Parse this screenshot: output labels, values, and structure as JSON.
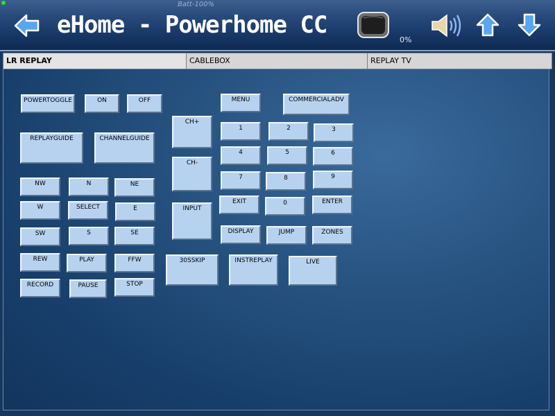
{
  "header": {
    "battery": "Batt-100%",
    "title": "eHome - Powerhome CC",
    "volume_percent": "0%",
    "icons": [
      "back-arrow-icon",
      "tv-screen-icon",
      "speaker-icon",
      "up-arrow-icon",
      "down-arrow-icon"
    ]
  },
  "tabs": [
    {
      "label": "LR REPLAY",
      "active": true
    },
    {
      "label": "CABLEBOX",
      "active": false
    },
    {
      "label": "REPLAY TV",
      "active": false
    }
  ],
  "buttons": {
    "powertoggle": "POWERTOGGLE",
    "on": "ON",
    "off": "OFF",
    "menu": "MENU",
    "commercialadv": "COMMERCIALADV",
    "ch_up": "CH+",
    "ch_down": "CH-",
    "replayguide": "REPLAYGUIDE",
    "channelguide": "CHANNELGUIDE",
    "n1": "1",
    "n2": "2",
    "n3": "3",
    "n4": "4",
    "n5": "5",
    "n6": "6",
    "n7": "7",
    "n8": "8",
    "n9": "9",
    "n0": "0",
    "nw": "NW",
    "n": "N",
    "ne": "NE",
    "w": "W",
    "select": "SELECT",
    "e": "E",
    "sw": "SW",
    "s": "S",
    "se": "SE",
    "exit": "EXIT",
    "enter": "ENTER",
    "input": "INPUT",
    "display": "DISPLAY",
    "jump": "JUMP",
    "zones": "ZONES",
    "rew": "REW",
    "play": "PLAY",
    "ffw": "FFW",
    "record": "RECORD",
    "pause": "PAUSE",
    "stop": "STOP",
    "skip30": "30SSKIP",
    "instreplay": "INSTREPLAY",
    "live": "LIVE"
  }
}
